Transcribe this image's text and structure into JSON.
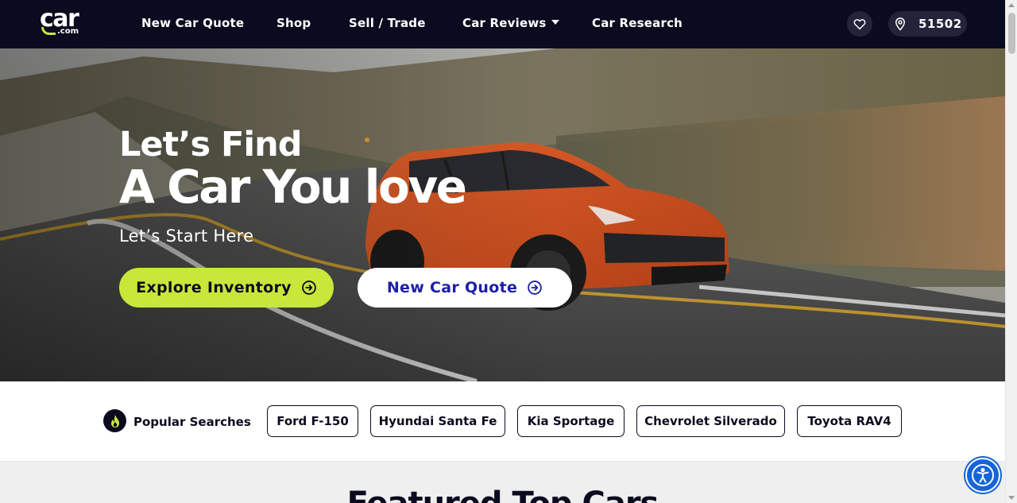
{
  "brand": {
    "logo_main": "car",
    "logo_sub": ".com",
    "accent": "#c7e73a",
    "nav_bg": "#0b0b1f",
    "link_blue": "#1c1fa8"
  },
  "header": {
    "nav": [
      {
        "label": "New Car Quote"
      },
      {
        "label": "Shop"
      },
      {
        "label": "Sell / Trade"
      },
      {
        "label": "Car Reviews",
        "has_dropdown": true
      },
      {
        "label": "Car Research"
      }
    ],
    "favorites_icon": "heart-icon",
    "location_icon": "map-pin-icon",
    "zip": "51502"
  },
  "hero": {
    "line1": "Let’s Find",
    "line2": "A Car You love",
    "subtitle": "Let’s Start Here",
    "explore_label": "Explore Inventory",
    "quote_label": "New Car Quote",
    "button_icon": "arrow-circle-right-icon"
  },
  "popular": {
    "label": "Popular Searches",
    "icon": "fire-icon",
    "chips": [
      "Ford F-150",
      "Hyundai Santa Fe",
      "Kia Sportage",
      "Chevrolet Silverado",
      "Toyota RAV4"
    ]
  },
  "featured": {
    "title": "Featured Top Cars"
  },
  "accessibility": {
    "icon": "accessibility-icon",
    "color": "#1565d8"
  }
}
